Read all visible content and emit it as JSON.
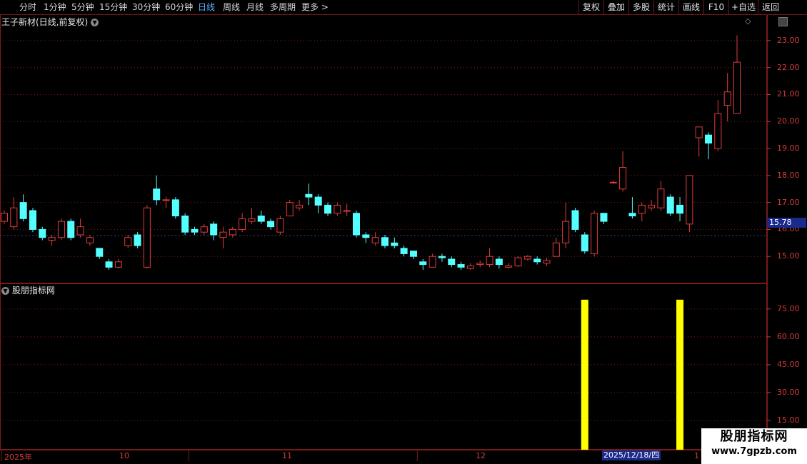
{
  "toolbar": {
    "periods": [
      "分时",
      "1分钟",
      "5分钟",
      "15分钟",
      "30分钟",
      "60分钟",
      "日线",
      "周线",
      "月线",
      "多周期",
      "更多 >"
    ],
    "active_period": "日线",
    "buttons": [
      "复权",
      "叠加",
      "多股",
      "统计",
      "画线",
      "F10",
      "+自选",
      "返回"
    ]
  },
  "main_chart": {
    "title": "王子新材(日线,前复权)",
    "current_price": "15.78",
    "y_ticks": [
      "23.00",
      "22.00",
      "21.00",
      "20.00",
      "19.00",
      "18.00",
      "17.00",
      "16.00",
      "15.00"
    ]
  },
  "indicator_panel": {
    "title": "股朋指标网",
    "y_ticks": [
      "75.00",
      "60.00",
      "45.00",
      "30.00",
      "15.00"
    ]
  },
  "x_axis": {
    "labels": [
      "2025年",
      "10",
      "11",
      "12",
      "1"
    ],
    "cursor_date": "2025/12/18/四"
  },
  "watermark": {
    "line1": "股朋指标网",
    "line2": "www.7gpzb.com"
  },
  "colors": {
    "up": "#e23b3b",
    "down": "#54ffff",
    "signal": "#ffff00",
    "grid": "#7a1a1a",
    "axis_text": "#d23b3b"
  },
  "chart_data": {
    "type": "candlestick",
    "ohlc": [
      [
        16.3,
        16.6,
        16.7,
        16.2
      ],
      [
        16.1,
        16.8,
        17.2,
        16.0
      ],
      [
        17.0,
        16.4,
        17.3,
        16.3
      ],
      [
        16.7,
        16.0,
        16.8,
        15.9
      ],
      [
        16.0,
        15.7,
        16.1,
        15.6
      ],
      [
        15.6,
        15.7,
        15.8,
        15.4
      ],
      [
        15.7,
        16.3,
        16.4,
        15.6
      ],
      [
        16.3,
        15.7,
        16.4,
        15.6
      ],
      [
        15.8,
        16.1,
        16.4,
        15.7
      ],
      [
        15.5,
        15.7,
        15.8,
        15.4
      ],
      [
        15.3,
        15.0,
        15.3,
        14.9
      ],
      [
        14.8,
        14.6,
        14.9,
        14.5
      ],
      [
        14.6,
        14.8,
        14.9,
        14.55
      ],
      [
        15.4,
        15.7,
        15.8,
        15.3
      ],
      [
        15.8,
        15.4,
        15.9,
        15.3
      ],
      [
        14.6,
        16.8,
        16.9,
        14.55
      ],
      [
        17.5,
        17.1,
        18.0,
        16.9
      ],
      [
        17.1,
        17.1,
        17.2,
        16.8
      ],
      [
        17.1,
        16.5,
        17.2,
        16.4
      ],
      [
        16.5,
        15.9,
        16.6,
        15.8
      ],
      [
        16.0,
        15.9,
        16.1,
        15.8
      ],
      [
        15.9,
        16.1,
        16.2,
        15.8
      ],
      [
        16.2,
        15.8,
        16.3,
        15.6
      ],
      [
        15.7,
        15.9,
        16.1,
        15.3
      ],
      [
        15.8,
        16.0,
        16.1,
        15.7
      ],
      [
        16.0,
        16.4,
        16.6,
        15.9
      ],
      [
        16.3,
        16.4,
        16.8,
        16.2
      ],
      [
        16.5,
        16.3,
        16.7,
        16.2
      ],
      [
        16.3,
        16.1,
        16.4,
        16.0
      ],
      [
        15.9,
        16.4,
        16.5,
        15.8
      ],
      [
        16.5,
        17.0,
        17.1,
        16.5
      ],
      [
        16.8,
        16.9,
        17.1,
        16.7
      ],
      [
        17.3,
        17.2,
        17.7,
        16.9
      ],
      [
        17.2,
        16.9,
        17.3,
        16.6
      ],
      [
        16.9,
        16.6,
        17.0,
        16.5
      ],
      [
        16.6,
        16.9,
        17.0,
        16.5
      ],
      [
        16.7,
        16.7,
        16.95,
        16.5
      ],
      [
        16.6,
        15.8,
        16.7,
        15.7
      ],
      [
        15.8,
        15.7,
        15.9,
        15.5
      ],
      [
        15.5,
        15.7,
        15.9,
        15.4
      ],
      [
        15.7,
        15.4,
        15.8,
        15.3
      ],
      [
        15.5,
        15.4,
        15.7,
        15.3
      ],
      [
        15.3,
        15.1,
        15.4,
        15.0
      ],
      [
        15.2,
        15.0,
        15.2,
        14.9
      ],
      [
        14.8,
        14.7,
        14.9,
        14.5
      ],
      [
        14.6,
        15.0,
        15.1,
        14.6
      ],
      [
        15.0,
        14.95,
        15.1,
        14.8
      ],
      [
        14.9,
        14.7,
        15.0,
        14.6
      ],
      [
        14.7,
        14.6,
        14.8,
        14.5
      ],
      [
        14.55,
        14.65,
        14.75,
        14.5
      ],
      [
        14.7,
        14.75,
        14.85,
        14.6
      ],
      [
        14.7,
        15.0,
        15.3,
        14.6
      ],
      [
        14.9,
        14.7,
        15.0,
        14.55
      ],
      [
        14.6,
        14.65,
        14.75,
        14.55
      ],
      [
        14.65,
        14.95,
        15.0,
        14.6
      ],
      [
        14.9,
        15.0,
        15.05,
        14.85
      ],
      [
        14.9,
        14.8,
        15.0,
        14.7
      ],
      [
        14.75,
        14.85,
        14.95,
        14.65
      ],
      [
        15.0,
        15.5,
        15.7,
        15.0
      ],
      [
        15.5,
        16.3,
        17.0,
        15.3
      ],
      [
        16.7,
        16.0,
        16.8,
        15.9
      ],
      [
        15.8,
        15.2,
        15.9,
        15.1
      ],
      [
        15.1,
        16.6,
        16.7,
        15.0
      ],
      [
        16.6,
        16.3,
        16.6,
        16.2
      ],
      [
        17.75,
        17.75,
        17.8,
        17.7
      ],
      [
        17.5,
        18.3,
        18.9,
        17.4
      ],
      [
        16.6,
        16.5,
        17.2,
        16.4
      ],
      [
        16.6,
        16.9,
        17.0,
        16.3
      ],
      [
        16.8,
        16.9,
        17.1,
        16.7
      ],
      [
        16.8,
        17.5,
        17.8,
        16.7
      ],
      [
        17.2,
        16.6,
        17.3,
        16.5
      ],
      [
        16.9,
        16.6,
        17.2,
        16.3
      ],
      [
        16.2,
        18.0,
        18.0,
        15.9
      ],
      [
        19.4,
        19.8,
        19.8,
        18.7
      ],
      [
        19.5,
        19.2,
        19.6,
        18.6
      ],
      [
        19.0,
        20.3,
        20.8,
        18.9
      ],
      [
        20.6,
        21.1,
        21.8,
        20.0
      ],
      [
        20.3,
        22.2,
        23.2,
        20.3
      ]
    ],
    "current_price": 15.78,
    "indicator": {
      "name": "股朋指标网",
      "signal_indices": [
        61,
        71
      ],
      "signal_value": 80
    },
    "main_ylim": [
      14.0,
      23.5
    ],
    "indicator_ylim": [
      0,
      88
    ]
  }
}
